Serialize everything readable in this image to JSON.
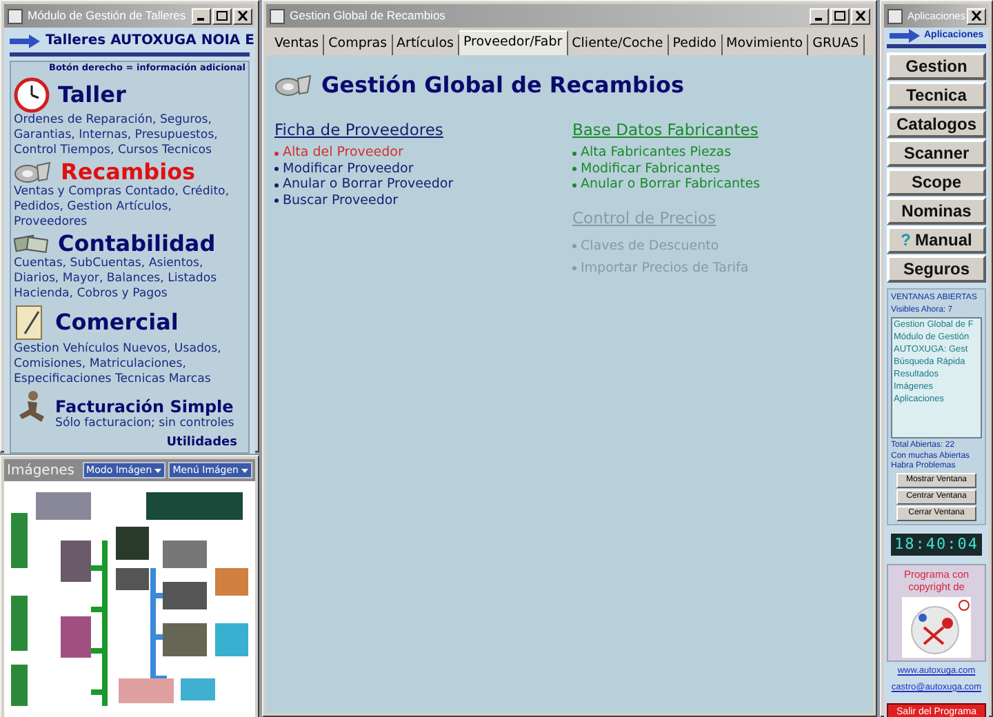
{
  "left_window": {
    "title": "Módulo de Gestión de Talleres",
    "header": "Talleres AUTOXUGA NOIA E",
    "hint": "Botón derecho = información adicional",
    "modules": [
      {
        "kind": "clock",
        "title": "Taller",
        "color": "#0a0a6e",
        "description": "Ordenes de Reparación, Seguros, Garantias, Internas, Presupuestos, Control Tiempos, Cursos Tecnicos"
      },
      {
        "kind": "parts",
        "title": "Recambios",
        "color": "#e01010",
        "description": "Ventas y Compras Contado, Crédito, Pedidos,  Gestion Artículos, Proveedores"
      },
      {
        "kind": "money",
        "title": "Contabilidad",
        "color": "#0a0a6e",
        "description": "Cuentas, SubCuentas, Asientos, Diarios, Mayor, Balances, Listados Hacienda, Cobros y Pagos"
      },
      {
        "kind": "paper",
        "title": "Comercial",
        "color": "#0a0a6e",
        "description": "Gestion Vehículos Nuevos, Usados, Comisiones, Matriculaciones, Especificaciones Tecnicas Marcas"
      },
      {
        "kind": "person",
        "title": "Facturación Simple",
        "color": "#0a0a6e",
        "description": "Sólo facturacion; sin controles"
      }
    ],
    "footer_link": "Utilidades"
  },
  "images_window": {
    "title": "Imágenes",
    "buttons": [
      "Modo Imágen",
      "Menú Imágen"
    ]
  },
  "main_window": {
    "title": "Gestion Global de Recambios",
    "tabs": [
      {
        "label": "Ventas",
        "selected": false
      },
      {
        "label": "Compras",
        "selected": false
      },
      {
        "label": "Artículos",
        "selected": false
      },
      {
        "label": "Proveedor/Fabr",
        "selected": true
      },
      {
        "label": "Cliente/Coche",
        "selected": false
      },
      {
        "label": "Pedido",
        "selected": false
      },
      {
        "label": "Movimiento",
        "selected": false
      },
      {
        "label": "GRUAS",
        "selected": false
      }
    ],
    "heading": "Gestión Global de Recambios",
    "sections": [
      {
        "title": "Ficha de Proveedores",
        "color": "#1a1a70",
        "disabled": false,
        "items": [
          {
            "label": "Alta del Proveedor",
            "highlighted": true
          },
          {
            "label": "Modificar Proveedor",
            "highlighted": false
          },
          {
            "label": "Anular o Borrar Proveedor",
            "highlighted": false
          },
          {
            "label": "Buscar Proveedor",
            "highlighted": false
          }
        ]
      },
      {
        "title": "Base Datos Fabricantes",
        "color": "#1a8a2a",
        "disabled": false,
        "items": [
          {
            "label": "Alta Fabricantes Piezas",
            "highlighted": false
          },
          {
            "label": "Modificar Fabricantes",
            "highlighted": false
          },
          {
            "label": "Anular o Borrar Fabricantes",
            "highlighted": false
          }
        ]
      },
      {
        "title": "Control de Precios",
        "disabled": true,
        "items": [
          {
            "label": "Claves de Descuento",
            "highlighted": false
          },
          {
            "label": "Importar Precios de Tarifa",
            "highlighted": false
          }
        ]
      }
    ]
  },
  "right_window": {
    "title": "Aplicaciones",
    "header": "Aplicaciones",
    "buttons": [
      {
        "label": "Gestion"
      },
      {
        "label": "Tecnica"
      },
      {
        "label": "Catalogos"
      },
      {
        "label": "Scanner"
      },
      {
        "label": "Scope"
      },
      {
        "label": "Nominas"
      },
      {
        "label": "Manual",
        "icon": "?"
      },
      {
        "label": "Seguros"
      }
    ],
    "open_windows": {
      "title": "VENTANAS ABIERTAS",
      "visible": "Visibles Ahora: 7",
      "items": [
        "Gestion Global de F",
        "Módulo de Gestión",
        "AUTOXUGA:  Gest",
        "Búsqueda Rápida",
        "Resultados",
        "Imágenes",
        "Aplicaciones"
      ],
      "total": "Total Abiertas: 22",
      "warning": "Con muchas Abiertas Habra Problemas",
      "buttons": [
        "Mostrar Ventana",
        "Centrar Ventana",
        "Cerrar Ventana"
      ]
    },
    "clock": "18:40:04",
    "copyright": "Programa con copyright de",
    "links": [
      "www.autoxuga.com",
      "castro@autoxuga.com"
    ],
    "exit": "Salir del Programa"
  }
}
